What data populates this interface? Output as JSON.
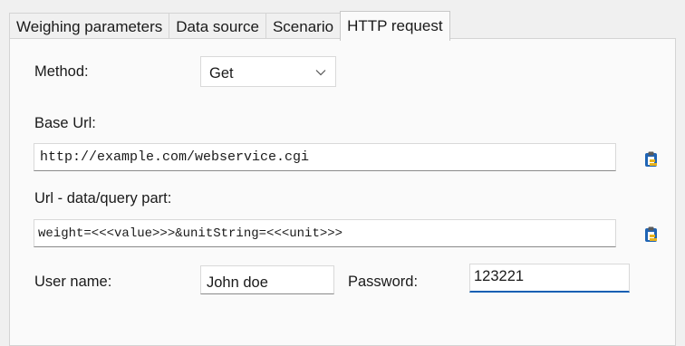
{
  "tabs": [
    {
      "label": "Weighing parameters",
      "active": false
    },
    {
      "label": "Data source",
      "active": false
    },
    {
      "label": "Scenario",
      "active": false
    },
    {
      "label": "HTTP request",
      "active": true
    }
  ],
  "form": {
    "method_label": "Method:",
    "method_value": "Get",
    "base_url_label": "Base Url:",
    "base_url_value": "http://example.com/webservice.cgi",
    "query_label": "Url - data/query part:",
    "query_value": "weight=<<<value>>>&unitString=<<<unit>>>",
    "username_label": "User name:",
    "username_value": "John doe",
    "password_label": "Password:",
    "password_value": "123221"
  },
  "icons": {
    "paste_icon": "clipboard-paste-icon",
    "dropdown_icon": "chevron-down-icon"
  },
  "colors": {
    "icon_blue": "#1f64b5",
    "icon_yellow": "#e8b21c",
    "focus_underline": "#0f5fb3"
  }
}
